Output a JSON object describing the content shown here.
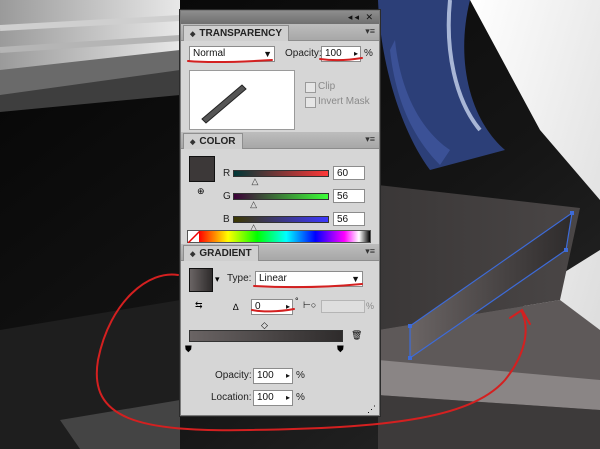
{
  "transparency": {
    "title": "TRANSPARENCY",
    "blend_mode": "Normal",
    "opacity_label": "Opacity:",
    "opacity_value": "100",
    "opacity_unit": "%",
    "clip_label": "Clip",
    "invert_mask_label": "Invert Mask"
  },
  "color": {
    "title": "COLOR",
    "channels": [
      {
        "label": "R",
        "value": "60",
        "level": 0.235
      },
      {
        "label": "G",
        "value": "56",
        "level": 0.22
      },
      {
        "label": "B",
        "value": "56",
        "level": 0.22
      }
    ],
    "fill_color": "#3c3838"
  },
  "gradient": {
    "title": "GRADIENT",
    "type_label": "Type:",
    "type_value": "Linear",
    "angle_value": "0",
    "angle_unit": "°",
    "aspect_unit": "%",
    "opacity_label": "Opacity:",
    "opacity_value": "100",
    "opacity_unit": "%",
    "location_label": "Location:",
    "location_value": "100",
    "location_unit": "%"
  },
  "colors": {
    "annotation": "#d42020",
    "selection": "#3d6bd8"
  }
}
